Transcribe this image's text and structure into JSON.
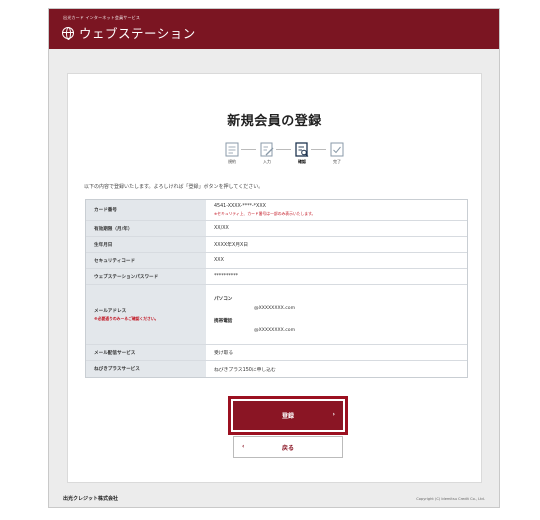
{
  "header": {
    "small_text": "出光カード インターネット会員サービス",
    "brand": "ウェブステーション"
  },
  "page": {
    "title": "新規会員の登録",
    "intro": "以下の内容で登録いたします。よろしければ「登録」ボタンを押してください。"
  },
  "steps": [
    {
      "label": "規約",
      "active": false
    },
    {
      "label": "入力",
      "active": false
    },
    {
      "label": "確認",
      "active": true
    },
    {
      "label": "完了",
      "active": false
    }
  ],
  "table": {
    "card_number": {
      "label": "カード番号",
      "value": "4541-XXXX-****-*XXX",
      "note": "※セキュリティ上、カード番号は一部のみ表示いたします。"
    },
    "expiry": {
      "label": "有効期限（月/年）",
      "value": "XX/XX"
    },
    "birthdate": {
      "label": "生年月日",
      "value": "XXXX年X月X日"
    },
    "security_code": {
      "label": "セキュリティコード",
      "value": "XXX"
    },
    "password": {
      "label": "ウェブステーションパスワード",
      "value": "**********"
    },
    "email": {
      "label": "メールアドレス",
      "note": "※必要通りのみーるご確認ください。",
      "pc_label": "パソコン",
      "pc_value": "@XXXXXXXX.com",
      "mobile_label": "携帯電話",
      "mobile_value": "@XXXXXXXX.com"
    },
    "mail_service": {
      "label": "メール配信サービス",
      "value": "受け取る"
    },
    "nebiki": {
      "label": "ねびきプラスサービス",
      "value": "ねびきプラス150に申し込む"
    }
  },
  "buttons": {
    "register": "登録",
    "back": "戻る",
    "register_arrow": "›",
    "back_arrow": "‹"
  },
  "footer": {
    "company": "出光クレジット株式会社",
    "copyright": "Copyright (C) Idemitsu Credit Co., Ltd."
  },
  "colors": {
    "brand": "#7b1522",
    "button": "#8a1524",
    "highlight": "#9b1020",
    "note": "#c1121f"
  }
}
